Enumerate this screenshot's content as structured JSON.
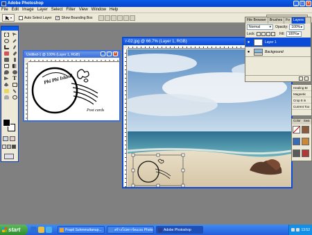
{
  "app": {
    "title": "Adobe Photoshop"
  },
  "menu": [
    "File",
    "Edit",
    "Image",
    "Layer",
    "Select",
    "Filter",
    "View",
    "Window",
    "Help"
  ],
  "options": {
    "auto_select_layer": "Auto Select Layer",
    "show_bounding_box": "Show Bounding Box"
  },
  "doc1": {
    "title": "Untitled-1 @ 100% (Layer 1, RGB)",
    "stamp_top": "Phi Phi Island",
    "stamp_bottom": "Post cards"
  },
  "doc2": {
    "title": "r-02.jpg @ 66.7% (Layer 1, RGB)"
  },
  "layers": {
    "tabs": [
      "File Browser",
      "Brushes",
      "Fo",
      "Layers"
    ],
    "blend_mode": "Normal",
    "opacity_label": "Opacity:",
    "opacity_value": "100%",
    "lock_label": "Lock:",
    "fill_label": "Fill:",
    "fill_value": "100%",
    "items": [
      {
        "name": "Layer 1",
        "active": true
      },
      {
        "name": "Background",
        "active": false
      }
    ]
  },
  "presets": {
    "items": [
      "Healing Br",
      "Magnetic",
      "Crop 8 in",
      "Current Too"
    ]
  },
  "color_panel": {
    "tabs": [
      "Color",
      "Swa"
    ]
  },
  "taskbar": {
    "start": "start",
    "tasks": [
      {
        "label": "Prapit Suhmmuttanup...",
        "active": false
      },
      {
        "label": "สร้างโปสการ์ดแบบ Photosh...",
        "active": false
      },
      {
        "label": "Adobe Photoshop",
        "active": true
      }
    ],
    "clock": "13:52"
  },
  "colors": {
    "xp_blue": "#0a4bd8",
    "start_green": "#2e8b2e",
    "taskbar": "#245edb"
  }
}
